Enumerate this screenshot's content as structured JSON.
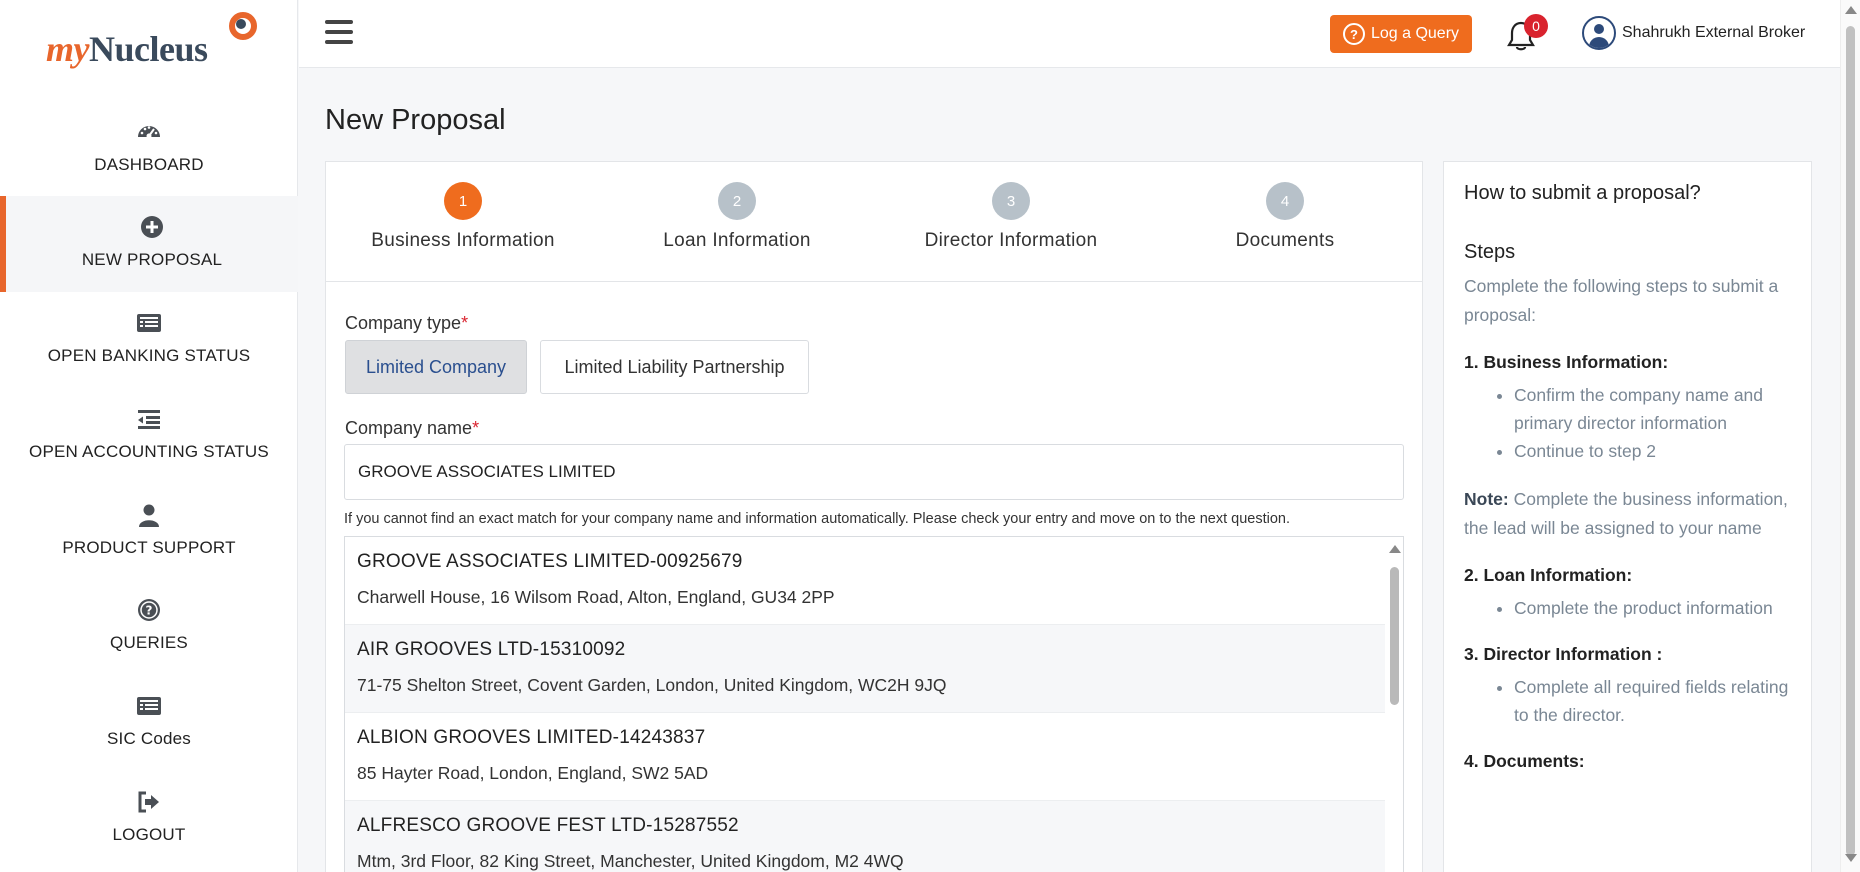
{
  "brand": {
    "my": "my",
    "nucleus": "Nucleus",
    "accent": "#e8662c"
  },
  "sidebar": {
    "items": [
      {
        "label": "DASHBOARD",
        "icon": "dashboard-icon"
      },
      {
        "label": "NEW PROPOSAL",
        "icon": "plus-circle-icon",
        "active": true
      },
      {
        "label": "OPEN BANKING STATUS",
        "icon": "list-card-icon"
      },
      {
        "label": "OPEN ACCOUNTING STATUS",
        "icon": "indent-list-icon"
      },
      {
        "label": "PRODUCT SUPPORT",
        "icon": "user-icon"
      },
      {
        "label": "QUERIES",
        "icon": "question-circle-icon"
      },
      {
        "label": "SIC Codes",
        "icon": "list-card-icon"
      },
      {
        "label": "LOGOUT",
        "icon": "logout-icon"
      }
    ]
  },
  "topbar": {
    "query_button": "Log a Query",
    "notification_count": "0",
    "user_name": "Shahrukh External Broker"
  },
  "page": {
    "title": "New Proposal"
  },
  "stepper": {
    "steps": [
      {
        "num": "1",
        "label": "Business Information"
      },
      {
        "num": "2",
        "label": "Loan Information"
      },
      {
        "num": "3",
        "label": "Director Information"
      },
      {
        "num": "4",
        "label": "Documents"
      }
    ]
  },
  "form": {
    "company_type_label": "Company type",
    "required_mark": "*",
    "company_types": [
      "Limited Company",
      "Limited Liability Partnership"
    ],
    "company_name_label": "Company name",
    "company_name_value": "GROOVE ASSOCIATES LIMITED",
    "hint": "If you cannot find an exact match for your company name and information automatically. Please check your entry and move on to the next question."
  },
  "results": [
    {
      "name": "GROOVE ASSOCIATES LIMITED-00925679",
      "address": "Charwell House, 16 Wilsom Road, Alton, England, GU34 2PP"
    },
    {
      "name": "AIR GROOVES LTD-15310092",
      "address": "71-75 Shelton Street, Covent Garden, London, United Kingdom, WC2H 9JQ"
    },
    {
      "name": "ALBION GROOVES LIMITED-14243837",
      "address": "85 Hayter Road, London, England, SW2 5AD"
    },
    {
      "name": "ALFRESCO GROOVE FEST LTD-15287552",
      "address": "Mtm, 3rd Floor, 82 King Street, Manchester, United Kingdom, M2 4WQ"
    }
  ],
  "help": {
    "title": "How to submit a proposal?",
    "steps_heading": "Steps",
    "intro": "Complete the following steps to submit a proposal:",
    "s1": "1. Business Information:",
    "s1_items": [
      "Confirm the company name and primary director information",
      "Continue to step 2"
    ],
    "note_label": "Note:",
    "note_text": " Complete the business information, the lead will be assigned to your name",
    "s2": "2. Loan Information:",
    "s2_items": [
      "Complete the product information"
    ],
    "s3": "3. Director Information :",
    "s3_items": [
      "Complete all required fields relating to the director."
    ],
    "s4": "4. Documents:"
  }
}
